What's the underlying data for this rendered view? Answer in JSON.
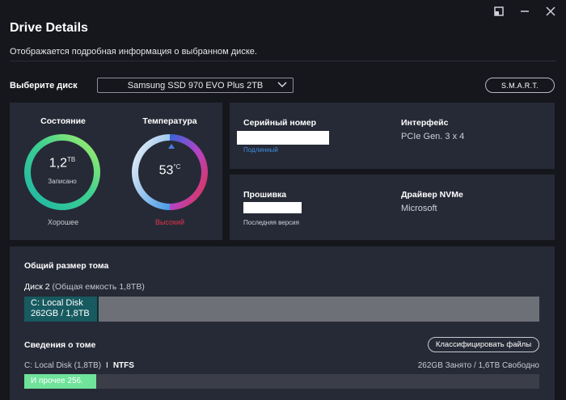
{
  "window": {
    "title": "Drive Details",
    "subtitle": "Отображается подробная информация о выбранном диске.",
    "controls": [
      "restore-icon",
      "minimize-icon",
      "close-icon"
    ]
  },
  "selector": {
    "label": "Выберите диск",
    "value": "Samsung SSD 970 EVO Plus 2TB",
    "smart_label": "S.M.A.R.T."
  },
  "status": {
    "title": "Состояние",
    "value": "1,2",
    "unit": "ТВ",
    "caption": "Записано",
    "verdict": "Хорошее",
    "verdict_color": "#c9ccd3"
  },
  "temperature": {
    "title": "Температура",
    "value": "53",
    "unit": "°C",
    "verdict": "Высокий",
    "verdict_color": "#e0334a",
    "level": 0.75
  },
  "serial": {
    "label": "Серийный номер",
    "note": "Подлинный",
    "note_color": "#3d8fe0"
  },
  "interface": {
    "label": "Интерфейс",
    "value": "PCIe Gen. 3 x 4"
  },
  "firmware": {
    "label": "Прошивка",
    "note": "Последняя версия"
  },
  "driver": {
    "label": "Драйвер NVMe",
    "value": "Microsoft"
  },
  "volume": {
    "title": "Общий размер тома",
    "disk_name": "Диск 2",
    "disk_capacity": "(Общая емкость 1,8TB)",
    "bar_label_1": "C: Local Disk",
    "bar_label_2": "262GB / 1,8TB",
    "used_fraction": 0.145,
    "info_title": "Сведения о томе",
    "classify_label": "Классифицировать файлы",
    "volume_name": "C: Local Disk (1,8TB)",
    "separator": "I",
    "filesystem": "NTFS",
    "usage": "262GB Занято / 1,6TB Свободно",
    "other_label": "И прочее 256.",
    "other_fraction": 0.14
  }
}
